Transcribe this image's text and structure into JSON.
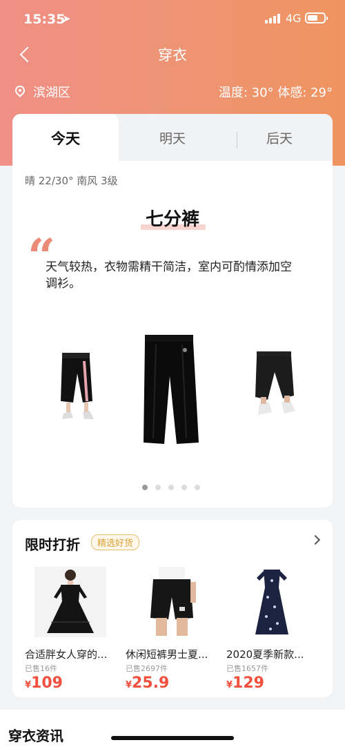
{
  "status": {
    "time": "15:35",
    "network": "4G"
  },
  "nav": {
    "title": "穿衣"
  },
  "location": {
    "district": "滨湖区",
    "temperature": "温度: 30°  体感: 29°"
  },
  "tabs": [
    {
      "label": "今天"
    },
    {
      "label": "明天"
    },
    {
      "label": "后天"
    }
  ],
  "forecast": {
    "weather_line": "晴 22/30° 南风 3级",
    "recommend_title": "七分裤",
    "tip": "天气较热，衣物需精干简洁，室内可酌情添加空调衫。"
  },
  "carousel": {
    "page_count": 5,
    "active_index": 0
  },
  "deals": {
    "title": "限时打折",
    "tag": "精选好货",
    "products": [
      {
        "name": "合适胖女人穿的...",
        "sold": "已售16件",
        "currency": "¥",
        "price": "109"
      },
      {
        "name": "休闲短裤男士夏...",
        "sold": "已售2697件",
        "currency": "¥",
        "price": "25.9"
      },
      {
        "name": "2020夏季新款...",
        "sold": "已售1657件",
        "currency": "¥",
        "price": "129"
      }
    ]
  },
  "news": {
    "title": "穿衣资讯"
  },
  "colors": {
    "accent": "#ef8f86",
    "price": "#f0503d",
    "tag": "#d9a23a"
  }
}
